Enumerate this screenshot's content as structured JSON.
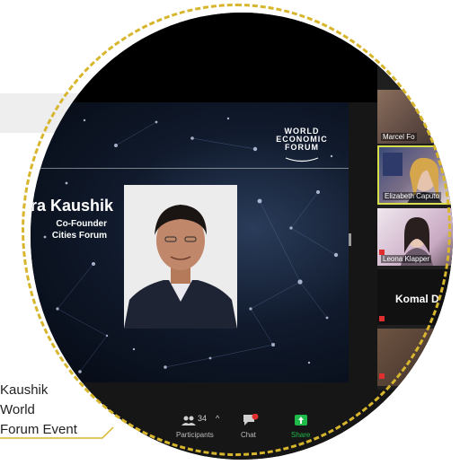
{
  "slide": {
    "org_line1": "WORLD",
    "org_line2": "ECONOMIC",
    "org_line3": "FORUM",
    "speaker_name": "ra Kaushik",
    "speaker_role_1": "Co-Founder",
    "speaker_role_2": "Cities Forum"
  },
  "participants_panel": {
    "tiles": [
      {
        "label": "Marcel Fo"
      },
      {
        "label": "Elizabeth Caputo"
      },
      {
        "label": "Leona Klapper"
      },
      {
        "label": "Komal D"
      }
    ]
  },
  "toolbar": {
    "participants_count": "34",
    "participants_label": "Participants",
    "chat_label": "Chat",
    "share_label": "Share"
  },
  "caption": {
    "line1": "Kaushik",
    "line2": "World",
    "line3": "Forum Event"
  },
  "colors": {
    "accent_gold": "#d7b62e",
    "active_speaker_border": "#d7e04a",
    "share_green": "#1fbb4a",
    "chat_badge_red": "#e02d2d"
  },
  "icons": [
    "participants-icon",
    "caret-up-icon",
    "chat-icon",
    "share-screen-icon",
    "mic-muted-icon",
    "wef-logo"
  ]
}
